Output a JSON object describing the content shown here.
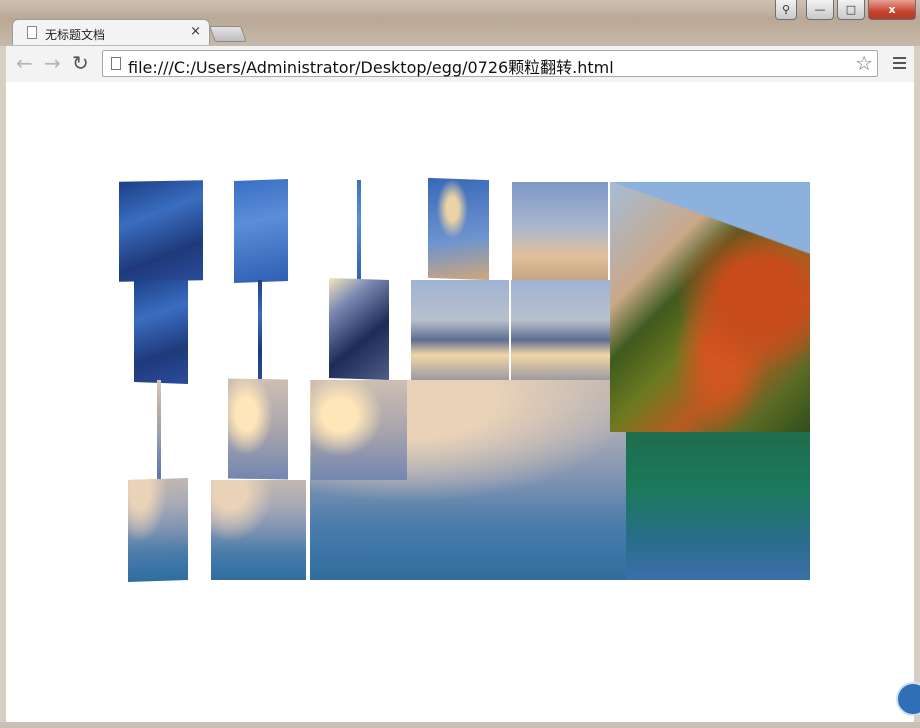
{
  "window": {
    "controls": {
      "minimize": "—",
      "maximize": "□",
      "close": "x"
    }
  },
  "tab": {
    "title": "无标题文档",
    "close_glyph": "×"
  },
  "toolbar": {
    "back_glyph": "←",
    "forward_glyph": "→",
    "reload_glyph": "↻",
    "url": "file:///C:/Users/Administrator/Desktop/egg/0726颗粒翻转.html",
    "star_glyph": "☆"
  },
  "icons": {
    "tab_page": "page-icon",
    "back": "back-arrow-icon",
    "forward": "forward-arrow-icon",
    "reload": "reload-icon",
    "bookmark": "star-icon",
    "menu": "menu-icon",
    "profile": "user-icon"
  },
  "content": {
    "image_description_tiles": "flipping-tiles"
  }
}
